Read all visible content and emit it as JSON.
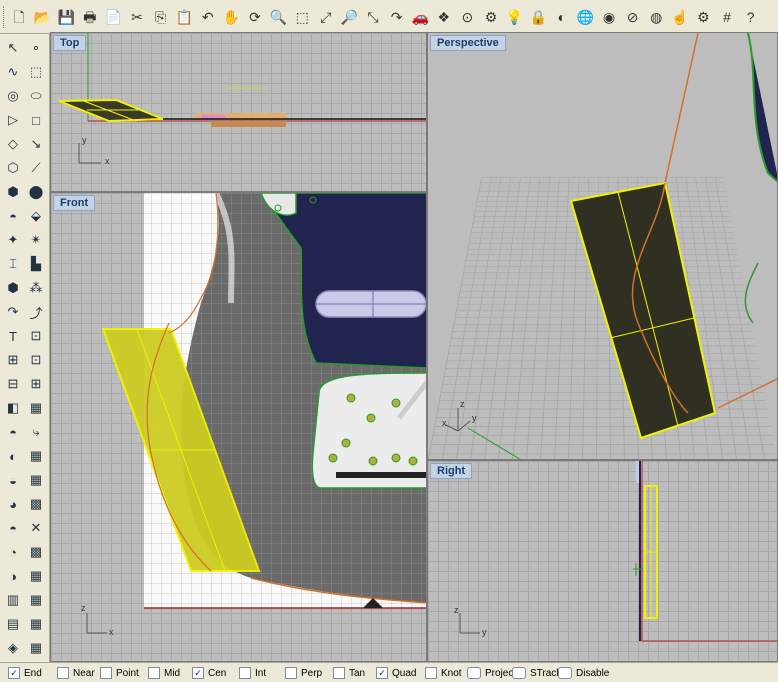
{
  "toolbar": {
    "icons": [
      "new-file",
      "open-file",
      "save",
      "print",
      "import",
      "cut",
      "copy",
      "paste",
      "undo",
      "pan",
      "rotate",
      "zoom",
      "zoom-window",
      "zoom-extents",
      "zoom-selected",
      "zoom-dynamic",
      "redo-view",
      "car",
      "layer-setup",
      "osnap",
      "properties",
      "lights",
      "lock",
      "shade",
      "render",
      "color",
      "material",
      "sphere",
      "pointer",
      "snap",
      "grid",
      "help"
    ],
    "glyphs": [
      "🗋",
      "📂",
      "💾",
      "🖶",
      "📄",
      "✂",
      "⎘",
      "📋",
      "↶",
      "✋",
      "⟳",
      "🔍",
      "⬚",
      "⤢",
      "🔎",
      "⤡",
      "↷",
      "🚗",
      "❖",
      "⊙",
      "⚙",
      "💡",
      "🔒",
      "◐",
      "🌐",
      "◉",
      "⊘",
      "◍",
      "☝",
      "⚙",
      "#",
      "?"
    ]
  },
  "left_tools": {
    "glyphs": [
      "↖",
      "∘",
      "∿",
      "⬚",
      "◎",
      "⬭",
      "▷",
      "□",
      "◇",
      "↘",
      "⬡",
      "⟋",
      "⬢",
      "⬤",
      "◓",
      "⬙",
      "✦",
      "✴",
      "⌶",
      "▙",
      "⬢",
      "⁂",
      "↷",
      "⤴",
      "T",
      "⊡",
      "⊞",
      "⊡",
      "⊟",
      "⊞",
      "◧",
      "▦",
      "◓",
      "⤷",
      "◐",
      "▦",
      "◒",
      "▦",
      "◕",
      "▩",
      "◓",
      "✕",
      "◔",
      "▩",
      "◑",
      "▦",
      "▥",
      "▦",
      "▤",
      "▦",
      "◈",
      "▦"
    ]
  },
  "viewports": {
    "top": {
      "title": "Top",
      "axis_x": "x",
      "axis_y": "y"
    },
    "perspective": {
      "title": "Perspective",
      "axis_x": "x",
      "axis_y": "y",
      "axis_z": "z"
    },
    "front": {
      "title": "Front",
      "axis_x": "x",
      "axis_y": "z"
    },
    "right": {
      "title": "Right",
      "axis_x": "y",
      "axis_y": "z"
    }
  },
  "osnaps": [
    {
      "label": "End",
      "checked": true
    },
    {
      "label": "Near",
      "checked": false
    },
    {
      "label": "Point",
      "checked": false
    },
    {
      "label": "Mid",
      "checked": false
    },
    {
      "label": "Cen",
      "checked": true
    },
    {
      "label": "Int",
      "checked": false
    },
    {
      "label": "Perp",
      "checked": false
    },
    {
      "label": "Tan",
      "checked": false
    },
    {
      "label": "Quad",
      "checked": true
    },
    {
      "label": "Knot",
      "checked": false
    }
  ],
  "status_panes": [
    "Project",
    "STrack",
    "Disable"
  ],
  "colors": {
    "selection": "#f2f200",
    "curve": "#d4702a",
    "pickguard": "#20244f",
    "grid": "#a8a8a8"
  }
}
